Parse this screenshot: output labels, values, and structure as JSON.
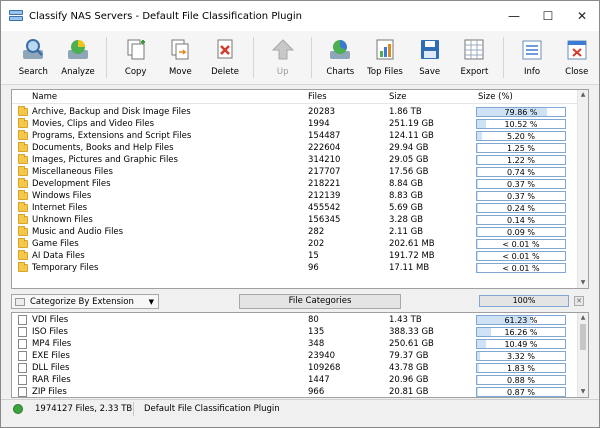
{
  "window": {
    "title": "Classify NAS Servers - Default File Classification Plugin"
  },
  "toolbar": {
    "buttons": [
      {
        "label": "Search",
        "icon": "search-icon"
      },
      {
        "label": "Analyze",
        "icon": "analyze-icon"
      },
      {
        "label": "Copy",
        "icon": "copy-icon"
      },
      {
        "label": "Move",
        "icon": "move-icon"
      },
      {
        "label": "Delete",
        "icon": "delete-icon"
      },
      {
        "label": "Up",
        "icon": "up-arrow-icon",
        "disabled": true
      },
      {
        "label": "Charts",
        "icon": "charts-icon"
      },
      {
        "label": "Top Files",
        "icon": "top-files-icon"
      },
      {
        "label": "Save",
        "icon": "save-icon"
      },
      {
        "label": "Export",
        "icon": "export-icon"
      },
      {
        "label": "Info",
        "icon": "info-icon"
      },
      {
        "label": "Close",
        "icon": "close-icon"
      }
    ]
  },
  "categories": {
    "columns": {
      "name": "Name",
      "files": "Files",
      "size": "Size",
      "pct": "Size (%)"
    },
    "rows": [
      {
        "name": "Archive, Backup and Disk Image Files",
        "files": "20283",
        "size": "1.86 TB",
        "pct": "79.86 %",
        "fill": 0.7986
      },
      {
        "name": "Movies, Clips and Video Files",
        "files": "1994",
        "size": "251.19 GB",
        "pct": "10.52 %",
        "fill": 0.1052
      },
      {
        "name": "Programs, Extensions and Script Files",
        "files": "154487",
        "size": "124.11 GB",
        "pct": "5.20 %",
        "fill": 0.052
      },
      {
        "name": "Documents, Books and Help Files",
        "files": "222604",
        "size": "29.94 GB",
        "pct": "1.25 %",
        "fill": 0.0125
      },
      {
        "name": "Images, Pictures and Graphic Files",
        "files": "314210",
        "size": "29.05 GB",
        "pct": "1.22 %",
        "fill": 0.0122
      },
      {
        "name": "Miscellaneous Files",
        "files": "217707",
        "size": "17.56 GB",
        "pct": "0.74 %",
        "fill": 0.0074
      },
      {
        "name": "Development Files",
        "files": "218221",
        "size": "8.84 GB",
        "pct": "0.37 %",
        "fill": 0.0037
      },
      {
        "name": "Windows Files",
        "files": "212139",
        "size": "8.83 GB",
        "pct": "0.37 %",
        "fill": 0.0037
      },
      {
        "name": "Internet Files",
        "files": "455542",
        "size": "5.69 GB",
        "pct": "0.24 %",
        "fill": 0.0024
      },
      {
        "name": "Unknown Files",
        "files": "156345",
        "size": "3.28 GB",
        "pct": "0.14 %",
        "fill": 0.0014
      },
      {
        "name": "Music and Audio Files",
        "files": "282",
        "size": "2.11 GB",
        "pct": "0.09 %",
        "fill": 0.0009
      },
      {
        "name": "Game Files",
        "files": "202",
        "size": "202.61 MB",
        "pct": "< 0.01 %",
        "fill": 0.0
      },
      {
        "name": "AI Data Files",
        "files": "15",
        "size": "191.72 MB",
        "pct": "< 0.01 %",
        "fill": 0.0
      },
      {
        "name": "Temporary Files",
        "files": "96",
        "size": "17.11 MB",
        "pct": "< 0.01 %",
        "fill": 0.0
      }
    ]
  },
  "midbar": {
    "dropdown": "Categorize By Extension",
    "button": "File Categories",
    "total": "100%",
    "close": "✕"
  },
  "extensions": {
    "rows": [
      {
        "name": "VDI Files",
        "files": "80",
        "size": "1.43 TB",
        "pct": "61.23 %",
        "fill": 0.6123
      },
      {
        "name": "ISO Files",
        "files": "135",
        "size": "388.33 GB",
        "pct": "16.26 %",
        "fill": 0.1626
      },
      {
        "name": "MP4 Files",
        "files": "348",
        "size": "250.61 GB",
        "pct": "10.49 %",
        "fill": 0.1049
      },
      {
        "name": "EXE Files",
        "files": "23940",
        "size": "79.37 GB",
        "pct": "3.32 %",
        "fill": 0.0332
      },
      {
        "name": "DLL Files",
        "files": "109268",
        "size": "43.78 GB",
        "pct": "1.83 %",
        "fill": 0.0183
      },
      {
        "name": "RAR Files",
        "files": "1447",
        "size": "20.96 GB",
        "pct": "0.88 %",
        "fill": 0.0088
      },
      {
        "name": "ZIP Files",
        "files": "966",
        "size": "20.81 GB",
        "pct": "0.87 %",
        "fill": 0.0087
      }
    ]
  },
  "status": {
    "summary": "1974127 Files, 2.33 TB",
    "plugin": "Default File Classification Plugin"
  }
}
